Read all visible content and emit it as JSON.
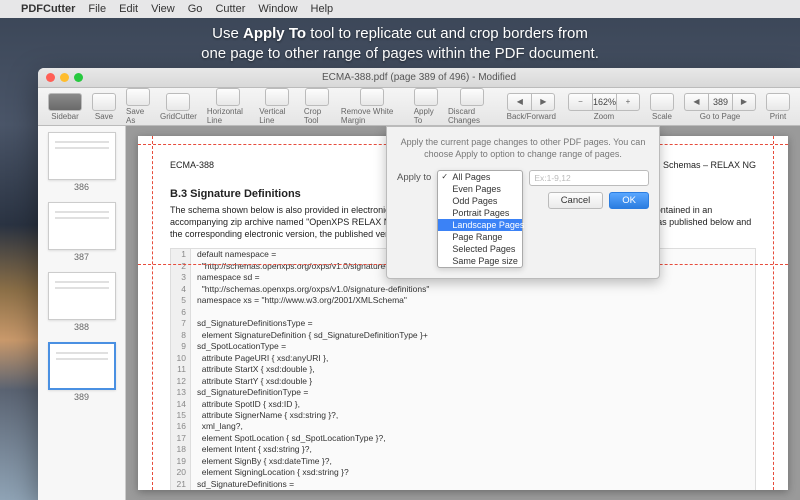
{
  "promo": {
    "line1_pre": "Use ",
    "line1_bold": "Apply To",
    "line1_post": " tool to replicate cut and crop borders from",
    "line2": "one page to other range of pages within the PDF document."
  },
  "menubar": {
    "apple": "",
    "items": [
      "PDFCutter",
      "File",
      "Edit",
      "View",
      "Go",
      "Cutter",
      "Window",
      "Help"
    ]
  },
  "window": {
    "title": "ECMA-388.pdf (page 389 of 496) - Modified"
  },
  "toolbar": {
    "sidebar": "Sidebar",
    "save": "Save",
    "saveas": "Save As",
    "gridcutter": "GridCutter",
    "hline": "Horizontal Line",
    "vline": "Vertical Line",
    "crop": "Crop Tool",
    "removewm": "Remove White Margin",
    "applyto": "Apply To",
    "discard": "Discard Changes",
    "backforward": "Back/Forward",
    "zoom": "Zoom",
    "zoom_value": "162%",
    "scale": "Scale",
    "page_field": "389",
    "goto": "Go to Page",
    "print": "Print"
  },
  "thumbs": [
    {
      "label": "386"
    },
    {
      "label": "387"
    },
    {
      "label": "388"
    },
    {
      "label": "389",
      "selected": true
    }
  ],
  "doc": {
    "hdr_left": "ECMA-388",
    "hdr_right": "B. Schemas – RELAX NG",
    "section": "B.3   Signature Definitions",
    "para": "The schema shown below is also provided in electronic form as a file named OpenXPSSignatureDefinitions.rnc, which is contained in an accompanying zip archive named \"OpenXPS RELAX NG Schemas.zip\". If discrepancies exist between the representation as published below and the corresponding electronic version, the published version below is the definitive version.",
    "code": [
      "default namespace =",
      "  \"http://schemas.openxps.org/oxps/v1.0/signature-definitions\"",
      "namespace sd =",
      "  \"http://schemas.openxps.org/oxps/v1.0/signature-definitions\"",
      "namespace xs = \"http://www.w3.org/2001/XMLSchema\"",
      "",
      "sd_SignatureDefinitionsType =",
      "  element SignatureDefinition { sd_SignatureDefinitionType }+",
      "sd_SpotLocationType =",
      "  attribute PageURI { xsd:anyURI },",
      "  attribute StartX { xsd:double },",
      "  attribute StartY { xsd:double }",
      "sd_SignatureDefinitionType =",
      "  attribute SpotID { xsd:ID },",
      "  attribute SignerName { xsd:string }?,",
      "  xml_lang?,",
      "  element SpotLocation { sd_SpotLocationType }?,",
      "  element Intent { xsd:string }?,",
      "  element SignBy { xsd:dateTime }?,",
      "  element SigningLocation { xsd:string }?",
      "sd_SignatureDefinitions ="
    ]
  },
  "popover": {
    "msg": "Apply the current page changes to other PDF pages. You can choose Apply to option to change range of pages.",
    "label": "Apply to",
    "options": [
      "All Pages",
      "Even Pages",
      "Odd Pages",
      "Portrait Pages",
      "Landscape Pages",
      "Page Range",
      "Selected Pages",
      "Same Page size"
    ],
    "checked_index": 0,
    "highlight_index": 4,
    "range_placeholder": "Ex:1-9,12",
    "cancel": "Cancel",
    "ok": "OK"
  }
}
